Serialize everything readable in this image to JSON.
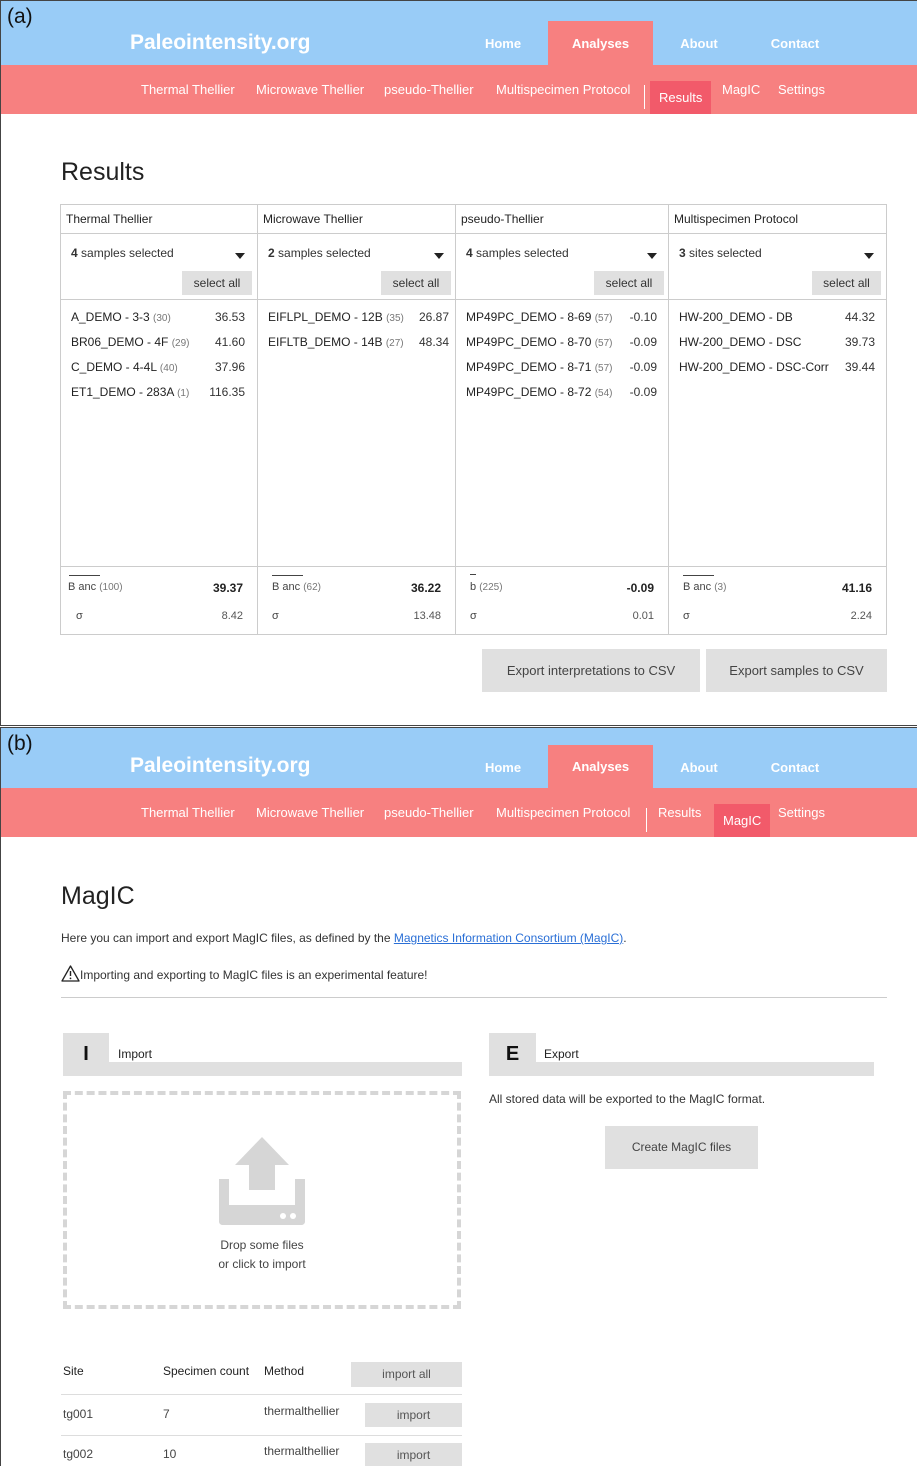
{
  "panel_a": {
    "label": "(a)",
    "brand": "Paleointensity.org",
    "topnav": [
      "Home",
      "Analyses",
      "About",
      "Contact"
    ],
    "subnav": [
      "Thermal Thellier",
      "Microwave Thellier",
      "pseudo-Thellier",
      "Multispecimen Protocol",
      "Results",
      "MagIC",
      "Settings"
    ],
    "page_title": "Results",
    "columns": [
      {
        "header": "Thermal Thellier",
        "selected_count": "4",
        "selected_text": " samples selected",
        "select_all": "select all",
        "items": [
          {
            "name": "A_DEMO - 3-3",
            "n": "(30)",
            "value": "36.53"
          },
          {
            "name": "BR06_DEMO - 4F",
            "n": "(29)",
            "value": "41.60"
          },
          {
            "name": "C_DEMO - 4-4L",
            "n": "(40)",
            "value": "37.96"
          },
          {
            "name": "ET1_DEMO - 283A",
            "n": "(1)",
            "value": "116.35"
          }
        ],
        "stat_label": "B anc",
        "stat_n": "(100)",
        "stat_value": "39.37",
        "sigma_label": "σ",
        "sigma_value": "8.42"
      },
      {
        "header": "Microwave Thellier",
        "selected_count": "2",
        "selected_text": " samples selected",
        "select_all": "select all",
        "items": [
          {
            "name": "EIFLPL_DEMO - 12B",
            "n": "(35)",
            "value": "26.87"
          },
          {
            "name": "EIFLTB_DEMO - 14B",
            "n": "(27)",
            "value": "48.34"
          }
        ],
        "stat_label": "B anc",
        "stat_n": "(62)",
        "stat_value": "36.22",
        "sigma_label": "σ",
        "sigma_value": "13.48"
      },
      {
        "header": "pseudo-Thellier",
        "selected_count": "4",
        "selected_text": " samples selected",
        "select_all": "select all",
        "items": [
          {
            "name": "MP49PC_DEMO - 8-69",
            "n": "(57)",
            "value": "-0.10"
          },
          {
            "name": "MP49PC_DEMO - 8-70",
            "n": "(57)",
            "value": "-0.09"
          },
          {
            "name": "MP49PC_DEMO - 8-71",
            "n": "(57)",
            "value": "-0.09"
          },
          {
            "name": "MP49PC_DEMO - 8-72",
            "n": "(54)",
            "value": "-0.09"
          }
        ],
        "stat_label": "b",
        "stat_n": "(225)",
        "stat_value": "-0.09",
        "sigma_label": "σ",
        "sigma_value": "0.01"
      },
      {
        "header": "Multispecimen Protocol",
        "selected_count": "3",
        "selected_text": " sites selected",
        "select_all": "select all",
        "items": [
          {
            "name": "HW-200_DEMO - DB",
            "n": "",
            "value": "44.32"
          },
          {
            "name": "HW-200_DEMO - DSC",
            "n": "",
            "value": "39.73"
          },
          {
            "name": "HW-200_DEMO - DSC-Corr",
            "n": "",
            "value": "39.44"
          }
        ],
        "stat_label": "B anc",
        "stat_n": "(3)",
        "stat_value": "41.16",
        "sigma_label": "σ",
        "sigma_value": "2.24"
      }
    ],
    "export_interpretations": "Export interpretations to CSV",
    "export_samples": "Export samples to CSV"
  },
  "panel_b": {
    "label": "(b)",
    "brand": "Paleointensity.org",
    "topnav": [
      "Home",
      "Analyses",
      "About",
      "Contact"
    ],
    "subnav": [
      "Thermal Thellier",
      "Microwave Thellier",
      "pseudo-Thellier",
      "Multispecimen Protocol",
      "Results",
      "MagIC",
      "Settings"
    ],
    "page_title": "MagIC",
    "desc_prefix": "Here you can import and export MagIC files, as defined by the ",
    "desc_link": "Magnetics Information Consortium (MagIC)",
    "desc_suffix": ".",
    "warning": "Importing and exporting to MagIC files is an experimental feature!",
    "import_letter": "I",
    "import_title": "Import",
    "export_letter": "E",
    "export_title": "Export",
    "export_desc": "All stored data will be exported to the MagIC format.",
    "create_button": "Create MagIC files",
    "drop_line1": "Drop some files",
    "drop_line2": "or click to import",
    "table_headers": [
      "Site",
      "Specimen count",
      "Method"
    ],
    "import_all": "import all",
    "rows": [
      {
        "site": "tg001",
        "count": "7",
        "method": "thermalthellier",
        "action": "import"
      },
      {
        "site": "tg002",
        "count": "10",
        "method": "thermalthellier",
        "action": "import"
      }
    ],
    "colors": {
      "top_bar": "#99ccf7",
      "sub_bar": "#f78080",
      "active": "#f25a6a",
      "link": "#2a6fd6"
    }
  }
}
